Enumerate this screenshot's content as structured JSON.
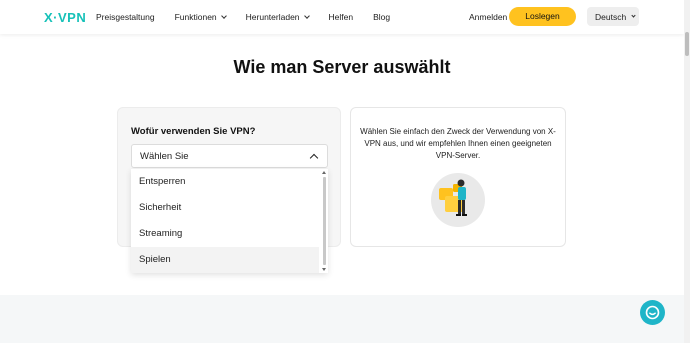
{
  "header": {
    "logo": "X·VPN",
    "nav": [
      {
        "label": "Preisgestaltung",
        "dropdown": false
      },
      {
        "label": "Funktionen",
        "dropdown": true
      },
      {
        "label": "Herunterladen",
        "dropdown": true
      },
      {
        "label": "Helfen",
        "dropdown": false
      },
      {
        "label": "Blog",
        "dropdown": false
      }
    ],
    "login": "Anmelden",
    "cta": "Loslegen",
    "language": "Deutsch"
  },
  "section": {
    "title": "Wie man Server auswählt"
  },
  "selector": {
    "question": "Wofür verwenden Sie VPN?",
    "selected": "Wählen Sie",
    "options": [
      "Entsperren",
      "Sicherheit",
      "Streaming",
      "Spielen"
    ],
    "hovered_option": "Spielen"
  },
  "info": {
    "description": "Wählen Sie einfach den Zweck der Verwendung von X-VPN aus, und wir empfehlen Ihnen einen geeigneten VPN-Server."
  },
  "colors": {
    "brand": "#16c1b8",
    "cta": "#ffc21f",
    "chat": "#1fb5c8"
  },
  "icons": [
    "chevron-down-icon",
    "chevron-up-icon",
    "illustration-person-icon",
    "chat-icon"
  ]
}
